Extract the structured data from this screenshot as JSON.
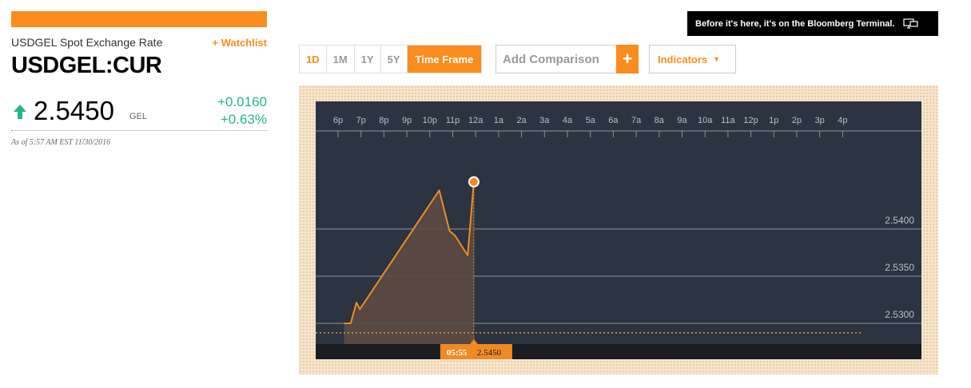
{
  "quote": {
    "name": "USDGEL Spot Exchange Rate",
    "watchlist_label": "+ Watchlist",
    "ticker": "USDGEL:CUR",
    "price": "2.5450",
    "currency": "GEL",
    "change_abs": "+0.0160",
    "change_pct": "+0.63%",
    "as_of": "As of 5:57 AM EST 11/30/2016",
    "up_color": "#25b77e"
  },
  "toolbar": {
    "timeframes": [
      "1D",
      "1M",
      "1Y",
      "5Y"
    ],
    "active": "1D",
    "timeframe_label": "Time Frame",
    "compare_placeholder": "Add Comparison",
    "compare_add": "+",
    "indicators_label": "Indicators",
    "indicators_caret": "▼"
  },
  "ad": {
    "text": "Before it's here, it's on the Bloomberg Terminal."
  },
  "colors": {
    "accent": "#fb8c1e",
    "chart_bg": "#2b3440",
    "chart_strip": "#1a1d21",
    "line": "#f08a24",
    "grid": "#8b939c"
  },
  "chart_data": {
    "type": "line",
    "x_ticks": [
      "6p",
      "7p",
      "8p",
      "9p",
      "10p",
      "11p",
      "12a",
      "1a",
      "2a",
      "3a",
      "4a",
      "5a",
      "6a",
      "7a",
      "8a",
      "9a",
      "10a",
      "11a",
      "12p",
      "1p",
      "2p",
      "3p",
      "4p"
    ],
    "y_ticks": [
      "2.5300",
      "2.5350",
      "2.5400"
    ],
    "ylim": [
      2.5278,
      2.5504
    ],
    "previous_close": 2.529,
    "points": [
      {
        "t": 0.26,
        "v": 2.53
      },
      {
        "t": 0.55,
        "v": 2.53
      },
      {
        "t": 0.8,
        "v": 2.5322
      },
      {
        "t": 0.95,
        "v": 2.5315
      },
      {
        "t": 4.41,
        "v": 2.5441
      },
      {
        "t": 4.86,
        "v": 2.5398
      },
      {
        "t": 5.1,
        "v": 2.5393
      },
      {
        "t": 5.65,
        "v": 2.5372
      },
      {
        "t": 5.92,
        "v": 2.545
      }
    ],
    "current_time": "05:55",
    "current_value": "2.5450"
  }
}
